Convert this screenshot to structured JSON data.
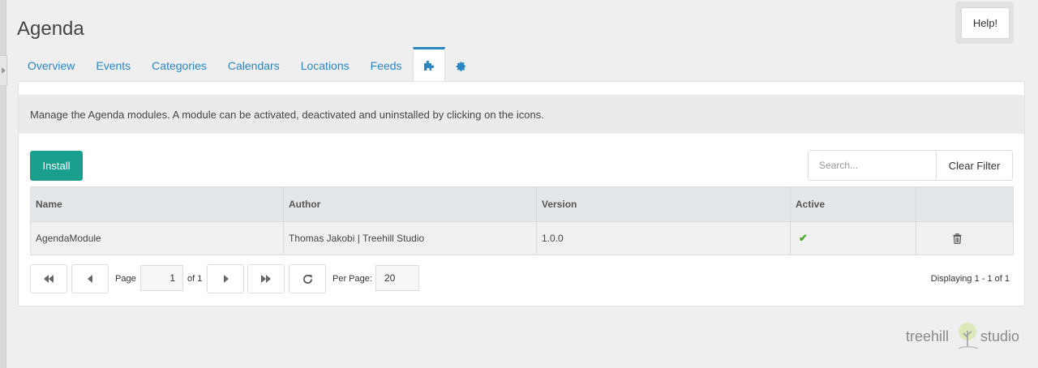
{
  "page": {
    "title": "Agenda"
  },
  "help": {
    "label": "Help!"
  },
  "tabs": [
    {
      "label": "Overview"
    },
    {
      "label": "Events"
    },
    {
      "label": "Categories"
    },
    {
      "label": "Calendars"
    },
    {
      "label": "Locations"
    },
    {
      "label": "Feeds"
    },
    {
      "icon": "puzzle-icon",
      "active": true
    },
    {
      "icon": "gear-icon"
    }
  ],
  "info": {
    "text": "Manage the Agenda modules. A module can be activated, deactivated and uninstalled by clicking on the icons."
  },
  "toolbar": {
    "install_label": "Install",
    "search_placeholder": "Search...",
    "clear_label": "Clear Filter"
  },
  "grid": {
    "columns": [
      "Name",
      "Author",
      "Version",
      "Active",
      ""
    ],
    "rows": [
      {
        "name": "AgendaModule",
        "author": "Thomas Jakobi | Treehill Studio",
        "version": "1.0.0",
        "active": "check-icon",
        "action": "trash-icon"
      }
    ]
  },
  "pager": {
    "page_label": "Page",
    "page_value": "1",
    "of_label": "of 1",
    "per_page_label": "Per Page:",
    "per_page_value": "20",
    "displaying": "Displaying 1 - 1 of 1"
  },
  "brand": {
    "left": "treehill",
    "right": "studio"
  },
  "colors": {
    "accent": "#2a86c3",
    "install": "#1a9f8f",
    "active_check": "#4aa82b"
  }
}
